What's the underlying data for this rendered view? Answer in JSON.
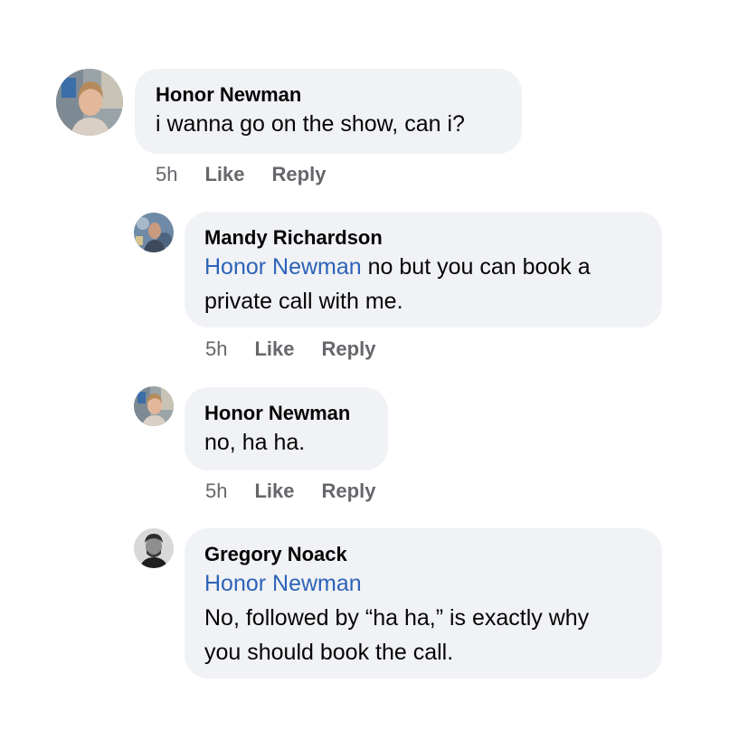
{
  "comments": [
    {
      "author": "Honor Newman",
      "text": "i wanna go on the show, can i?",
      "time": "5h",
      "like": "Like",
      "reply": "Reply"
    },
    {
      "author": "Mandy Richardson",
      "mention": "Honor Newman",
      "text_line1": " no but you can book a",
      "text_line2": "private call with me.",
      "time": "5h",
      "like": "Like",
      "reply": "Reply"
    },
    {
      "author": "Honor Newman",
      "text": "no, ha ha.",
      "time": "5h",
      "like": "Like",
      "reply": "Reply"
    },
    {
      "author": "Gregory Noack",
      "mention": "Honor Newman",
      "text_line1": "No, followed by “ha ha,” is exactly why",
      "text_line2": "you should book the call."
    }
  ],
  "colors": {
    "bubble": "#f0f2f5",
    "mention": "#2d63b8",
    "meta": "#65676b"
  }
}
